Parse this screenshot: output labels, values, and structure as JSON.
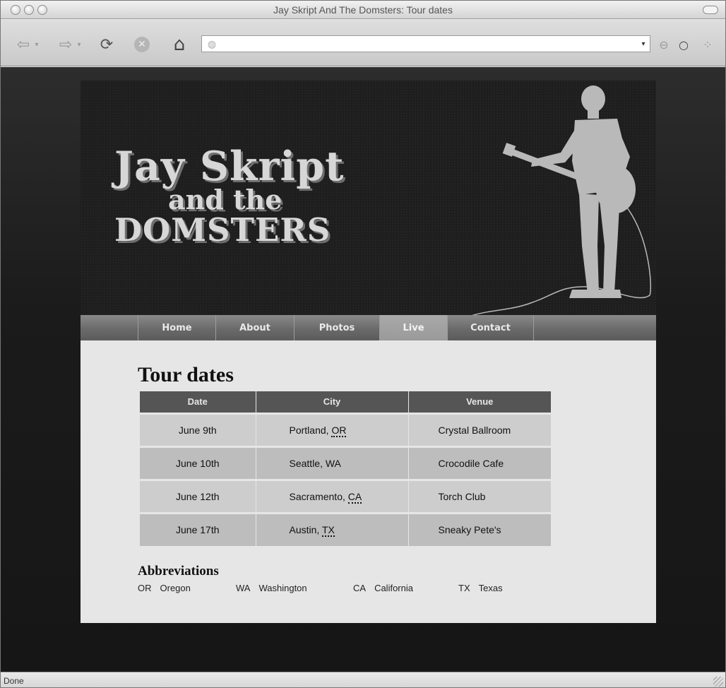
{
  "window": {
    "title": "Jay Skript And The Domsters: Tour dates"
  },
  "toolbar": {
    "back_icon": "back-arrow-icon",
    "forward_icon": "forward-arrow-icon",
    "reload_icon": "reload-icon",
    "stop_icon": "stop-icon",
    "home_icon": "home-icon",
    "url_value": ""
  },
  "header": {
    "logo_line1": "Jay Skript",
    "logo_line2": "and the",
    "logo_line3": "DOMSTERS"
  },
  "nav": {
    "items": [
      {
        "label": "Home",
        "active": false
      },
      {
        "label": "About",
        "active": false
      },
      {
        "label": "Photos",
        "active": false
      },
      {
        "label": "Live",
        "active": true
      },
      {
        "label": "Contact",
        "active": false
      }
    ]
  },
  "content": {
    "title": "Tour dates",
    "table": {
      "headers": [
        "Date",
        "City",
        "Venue"
      ],
      "rows": [
        {
          "date": "June 9th",
          "city": "Portland, ",
          "state": "OR",
          "venue": "Crystal Ballroom"
        },
        {
          "date": "June 10th",
          "city": "Seattle, WA",
          "state": "",
          "venue": "Crocodile Cafe"
        },
        {
          "date": "June 12th",
          "city": "Sacramento, ",
          "state": "CA",
          "venue": "Torch Club"
        },
        {
          "date": "June 17th",
          "city": "Austin, ",
          "state": "TX",
          "venue": "Sneaky Pete's"
        }
      ]
    },
    "abbreviations_heading": "Abbreviations",
    "abbreviations": [
      {
        "code": "OR",
        "name": "Oregon"
      },
      {
        "code": "WA",
        "name": "Washington"
      },
      {
        "code": "CA",
        "name": "California"
      },
      {
        "code": "TX",
        "name": "Texas"
      }
    ]
  },
  "statusbar": {
    "text": "Done"
  },
  "colors": {
    "page_background": "#1b1b1b",
    "masthead": "#1e1e1e",
    "nav": "#6a6a6a",
    "nav_active": "#a0a0a0",
    "content": "#e6e6e6",
    "table_header": "#555555",
    "row_odd": "#cdcdcd",
    "row_even": "#bdbdbd"
  }
}
